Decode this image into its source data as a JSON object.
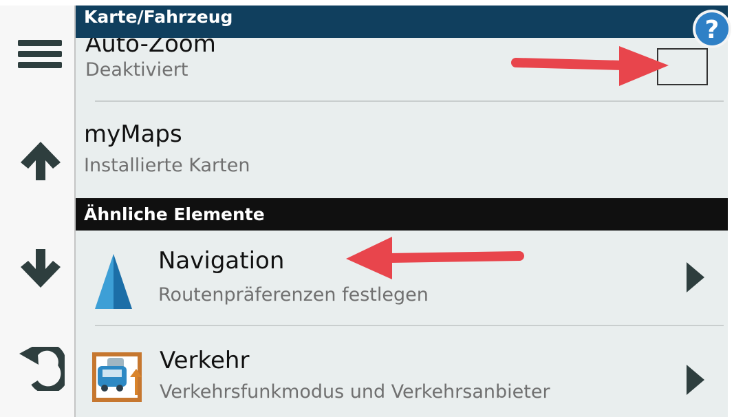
{
  "header": {
    "title": "Karte/Fahrzeug",
    "help_icon": "question-mark-icon",
    "help_label": "?"
  },
  "sidebar": {
    "items": [
      {
        "icon": "menu-icon"
      },
      {
        "icon": "arrow-up-icon"
      },
      {
        "icon": "arrow-down-icon"
      },
      {
        "icon": "back-icon"
      }
    ]
  },
  "settings": {
    "auto_zoom": {
      "title": "Auto-Zoom",
      "subtitle": "Deaktiviert",
      "checked": false
    },
    "mymaps": {
      "title": "myMaps",
      "subtitle": "Installierte Karten"
    }
  },
  "related": {
    "header": "Ähnliche Elemente",
    "items": [
      {
        "title": "Navigation",
        "subtitle": "Routenpräferenzen festlegen",
        "icon": "navigation-arrow-icon"
      },
      {
        "title": "Verkehr",
        "subtitle": "Verkehrsfunkmodus und Verkehrsanbieter",
        "icon": "traffic-icon"
      }
    ]
  },
  "colors": {
    "title_bar": "#103f5e",
    "section_header": "#101010",
    "annotation_arrow": "#e8454c",
    "nav_icon": "#2a88c4"
  }
}
